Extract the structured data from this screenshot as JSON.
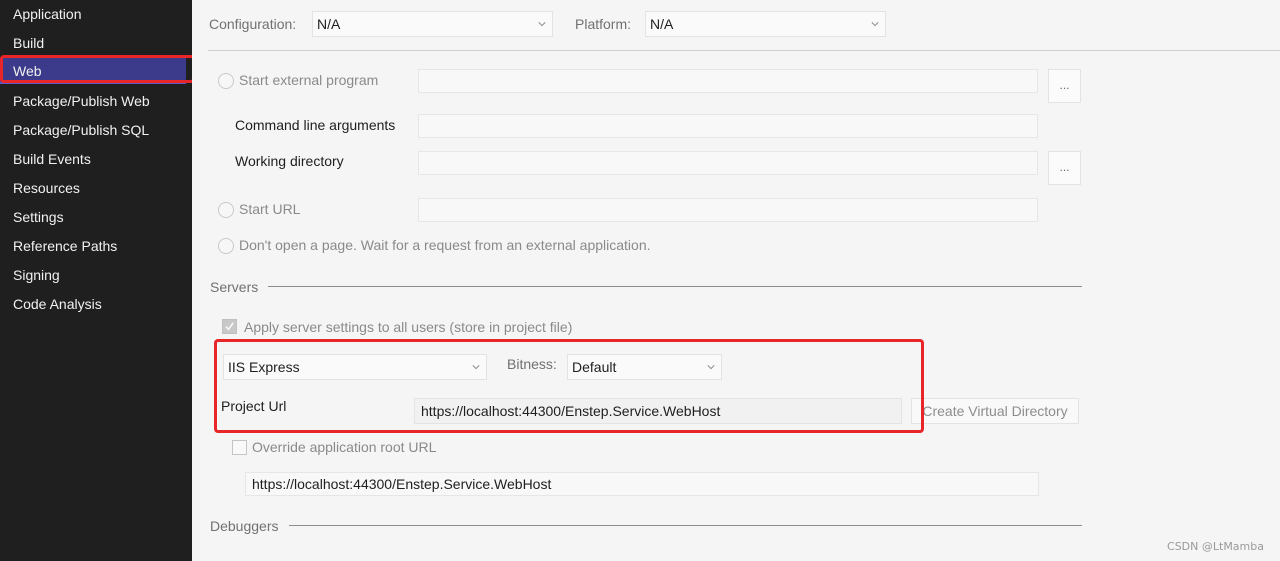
{
  "sidebar": {
    "items": [
      {
        "label": "Application"
      },
      {
        "label": "Build"
      },
      {
        "label": "Web"
      },
      {
        "label": "Package/Publish Web"
      },
      {
        "label": "Package/Publish SQL"
      },
      {
        "label": "Build Events"
      },
      {
        "label": "Resources"
      },
      {
        "label": "Settings"
      },
      {
        "label": "Reference Paths"
      },
      {
        "label": "Signing"
      },
      {
        "label": "Code Analysis"
      }
    ],
    "active": "Web"
  },
  "header": {
    "configuration_label": "Configuration:",
    "configuration_value": "N/A",
    "platform_label": "Platform:",
    "platform_value": "N/A"
  },
  "start_action": {
    "start_external_label": "Start external program",
    "external_program_value": "",
    "browse_label": "...",
    "cmd_args_label": "Command line arguments",
    "cmd_args_value": "",
    "working_dir_label": "Working directory",
    "working_dir_value": "",
    "start_url_label": "Start URL",
    "start_url_value": "",
    "dont_open_label": "Don't open a page.  Wait for a request from an external application."
  },
  "servers": {
    "section_label": "Servers",
    "apply_all_label": "Apply server settings to all users (store in project file)",
    "apply_all_checked": true,
    "server_value": "IIS Express",
    "bitness_label": "Bitness:",
    "bitness_value": "Default",
    "project_url_label": "Project Url",
    "project_url_value": "https://localhost:44300/Enstep.Service.WebHost",
    "create_vdir_label": "Create Virtual Directory",
    "override_root_label": "Override application root URL",
    "override_root_checked": false,
    "override_root_value": "https://localhost:44300/Enstep.Service.WebHost"
  },
  "debuggers": {
    "section_label": "Debuggers"
  },
  "watermark": "CSDN @LtMamba",
  "colors": {
    "sidebar_bg": "#1f1f1f",
    "active_item_bg": "#3c3a8a",
    "highlight_red": "#e8262a"
  }
}
